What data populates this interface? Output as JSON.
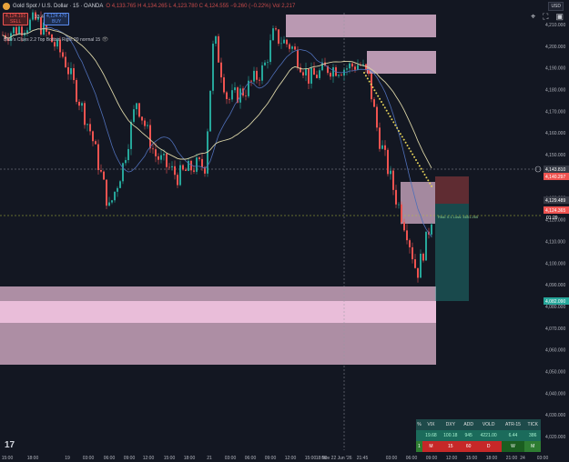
{
  "header": {
    "symbol": "Gold Spot / U.S. Dollar · 15 · OANDA",
    "ohlc": "O 4,133.765 H 4,134.265 L 4,123.780 C 4,124.555 −9.260 (−0.22%) Vol 2,217",
    "sell_price": "4,124.191",
    "sell_label": "SELL",
    "spread": "33.4",
    "buy_price": "4,124.470",
    "buy_label": "BUY"
  },
  "indicator_label": "Blue's Clues 2.2 Top Bottom Right 20 normal 15",
  "currency": "USD",
  "price_axis": [
    "4,210.000",
    "4,200.000",
    "4,190.000",
    "4,180.000",
    "4,170.000",
    "4,160.000",
    "4,150.000",
    "4,140.000",
    "4,130.000",
    "4,120.000",
    "4,110.000",
    "4,100.000",
    "4,090.000",
    "4,080.000",
    "4,070.000",
    "4,060.000",
    "4,050.000",
    "4,040.000",
    "4,030.000",
    "4,020.000"
  ],
  "price_labels": {
    "crosshair": "4,143.810",
    "sl": "4,140.297",
    "current": "4,129.489",
    "last": "4,124.365",
    "last_time": "01:29",
    "tp": "4,082.090"
  },
  "position_label": "Risk: 0.1 Loss: 4651.265",
  "time_axis": [
    "15:00",
    "18:00",
    "19",
    "03:00",
    "06:00",
    "09:00",
    "12:00",
    "15:00",
    "18:00",
    "21",
    "03:00",
    "06:00",
    "09:00",
    "12:00",
    "15:00",
    "18:00",
    "Nov 22 Jun '26",
    "21:45",
    "03:00",
    "06:00",
    "09:00",
    "12:00",
    "15:00",
    "18:00",
    "21:00",
    "24",
    "03:00"
  ],
  "table": {
    "headers": [
      "%",
      "VIX",
      "DXY",
      "ADD",
      "VOLD",
      "ATR-15",
      "TICK"
    ],
    "row1": [
      "",
      "19.68",
      "100.18",
      "945",
      "4221.00",
      "6.44",
      "386"
    ],
    "row2": [
      "1",
      "M",
      "15",
      "60",
      "D",
      "W",
      "M"
    ]
  },
  "colors": {
    "background": "#131722",
    "zone": "#f3c6e3",
    "up": "#26a69a",
    "down": "#ef5350",
    "ema_gold": "#e6d35a"
  },
  "icons": [
    "crosshair-icon",
    "fullscreen-icon",
    "camera-icon",
    "tradingview-logo"
  ]
}
